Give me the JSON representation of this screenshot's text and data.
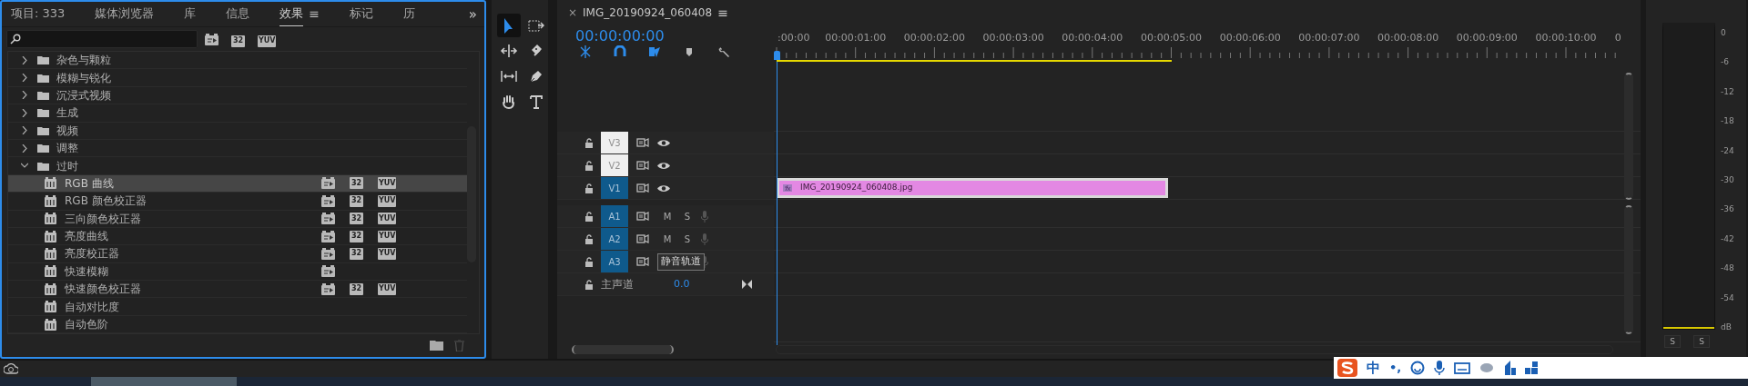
{
  "panel_tabs": [
    {
      "label": "项目: 333",
      "selected": false
    },
    {
      "label": "媒体浏览器",
      "selected": false
    },
    {
      "label": "库",
      "selected": false
    },
    {
      "label": "信息",
      "selected": false
    },
    {
      "label": "效果",
      "selected": true,
      "menu": "≡"
    },
    {
      "label": "标记",
      "selected": false
    },
    {
      "label": "历",
      "selected": false
    }
  ],
  "overflow": "»",
  "filter_buttons": [
    {
      "kind": "accelerated"
    },
    {
      "kind": "text",
      "label": "32"
    },
    {
      "kind": "text",
      "label": "YUV"
    }
  ],
  "effects_tree": [
    {
      "label": "杂色与颗粒",
      "expanded": false
    },
    {
      "label": "模糊与锐化",
      "expanded": false
    },
    {
      "label": "沉浸式视频",
      "expanded": false
    },
    {
      "label": "生成",
      "expanded": false
    },
    {
      "label": "视频",
      "expanded": false
    },
    {
      "label": "调整",
      "expanded": false
    },
    {
      "label": "过时",
      "expanded": true,
      "children": [
        {
          "label": "RGB 曲线",
          "selected": true,
          "badges": [
            {
              "kind": "accelerated"
            },
            {
              "kind": "text",
              "label": "32"
            },
            {
              "kind": "text",
              "label": "YUV"
            }
          ]
        },
        {
          "label": "RGB 颜色校正器",
          "selected": false,
          "badges": [
            {
              "kind": "accelerated"
            },
            {
              "kind": "text",
              "label": "32"
            },
            {
              "kind": "text",
              "label": "YUV"
            }
          ]
        },
        {
          "label": "三向颜色校正器",
          "selected": false,
          "badges": [
            {
              "kind": "accelerated"
            },
            {
              "kind": "text",
              "label": "32"
            },
            {
              "kind": "text",
              "label": "YUV"
            }
          ]
        },
        {
          "label": "亮度曲线",
          "selected": false,
          "badges": [
            {
              "kind": "accelerated"
            },
            {
              "kind": "text",
              "label": "32"
            },
            {
              "kind": "text",
              "label": "YUV"
            }
          ]
        },
        {
          "label": "亮度校正器",
          "selected": false,
          "badges": [
            {
              "kind": "accelerated"
            },
            {
              "kind": "text",
              "label": "32"
            },
            {
              "kind": "text",
              "label": "YUV"
            }
          ]
        },
        {
          "label": "快速模糊",
          "selected": false,
          "badges": [
            {
              "kind": "accelerated"
            }
          ]
        },
        {
          "label": "快速颜色校正器",
          "selected": false,
          "badges": [
            {
              "kind": "accelerated"
            },
            {
              "kind": "text",
              "label": "32"
            },
            {
              "kind": "text",
              "label": "YUV"
            }
          ]
        },
        {
          "label": "自动对比度",
          "selected": false
        },
        {
          "label": "自动色阶",
          "selected": false
        }
      ]
    }
  ],
  "tools": [
    {
      "kind": "select",
      "selected": true
    },
    {
      "kind": "track-select",
      "selected": false
    },
    {
      "kind": "ripple",
      "selected": false
    },
    {
      "kind": "razor",
      "selected": false
    },
    {
      "kind": "slip",
      "selected": false
    },
    {
      "kind": "pen",
      "selected": false
    },
    {
      "kind": "hand",
      "selected": false
    },
    {
      "kind": "type",
      "selected": false
    }
  ],
  "sequence": {
    "close": "×",
    "title": "IMG_20190924_060408",
    "menu": "≡",
    "timecode": "00:00:00:00",
    "ruler_labels": [
      ":00:00",
      "00:00:01:00",
      "00:00:02:00",
      "00:00:03:00",
      "00:00:04:00",
      "00:00:05:00",
      "00:00:06:00",
      "00:00:07:00",
      "00:00:08:00",
      "00:00:09:00",
      "00:00:10:00",
      "0"
    ]
  },
  "tracks": [
    {
      "kind": "video",
      "label": "V3",
      "targeted": false
    },
    {
      "kind": "video",
      "label": "V2",
      "targeted": false
    },
    {
      "kind": "video",
      "label": "V1",
      "targeted": true,
      "clip": "IMG_20190924_060408.jpg"
    },
    {
      "kind": "audio",
      "label": "A1",
      "targeted": true,
      "mute": "M",
      "solo": "S"
    },
    {
      "kind": "audio",
      "label": "A2",
      "targeted": true,
      "mute": "M",
      "solo": "S"
    },
    {
      "kind": "audio",
      "label": "A3",
      "targeted": true
    },
    {
      "kind": "master",
      "label": "主声道",
      "value": "0.0"
    }
  ],
  "tooltip": "静音轨道",
  "meter": {
    "scale": [
      "0",
      "-6",
      "-12",
      "-18",
      "-24",
      "-30",
      "-36",
      "-42",
      "-48",
      "-54",
      "dB"
    ],
    "solo_buttons": [
      "S",
      "S"
    ]
  },
  "ime": {
    "mode": "中",
    "punctuation": "•,"
  }
}
